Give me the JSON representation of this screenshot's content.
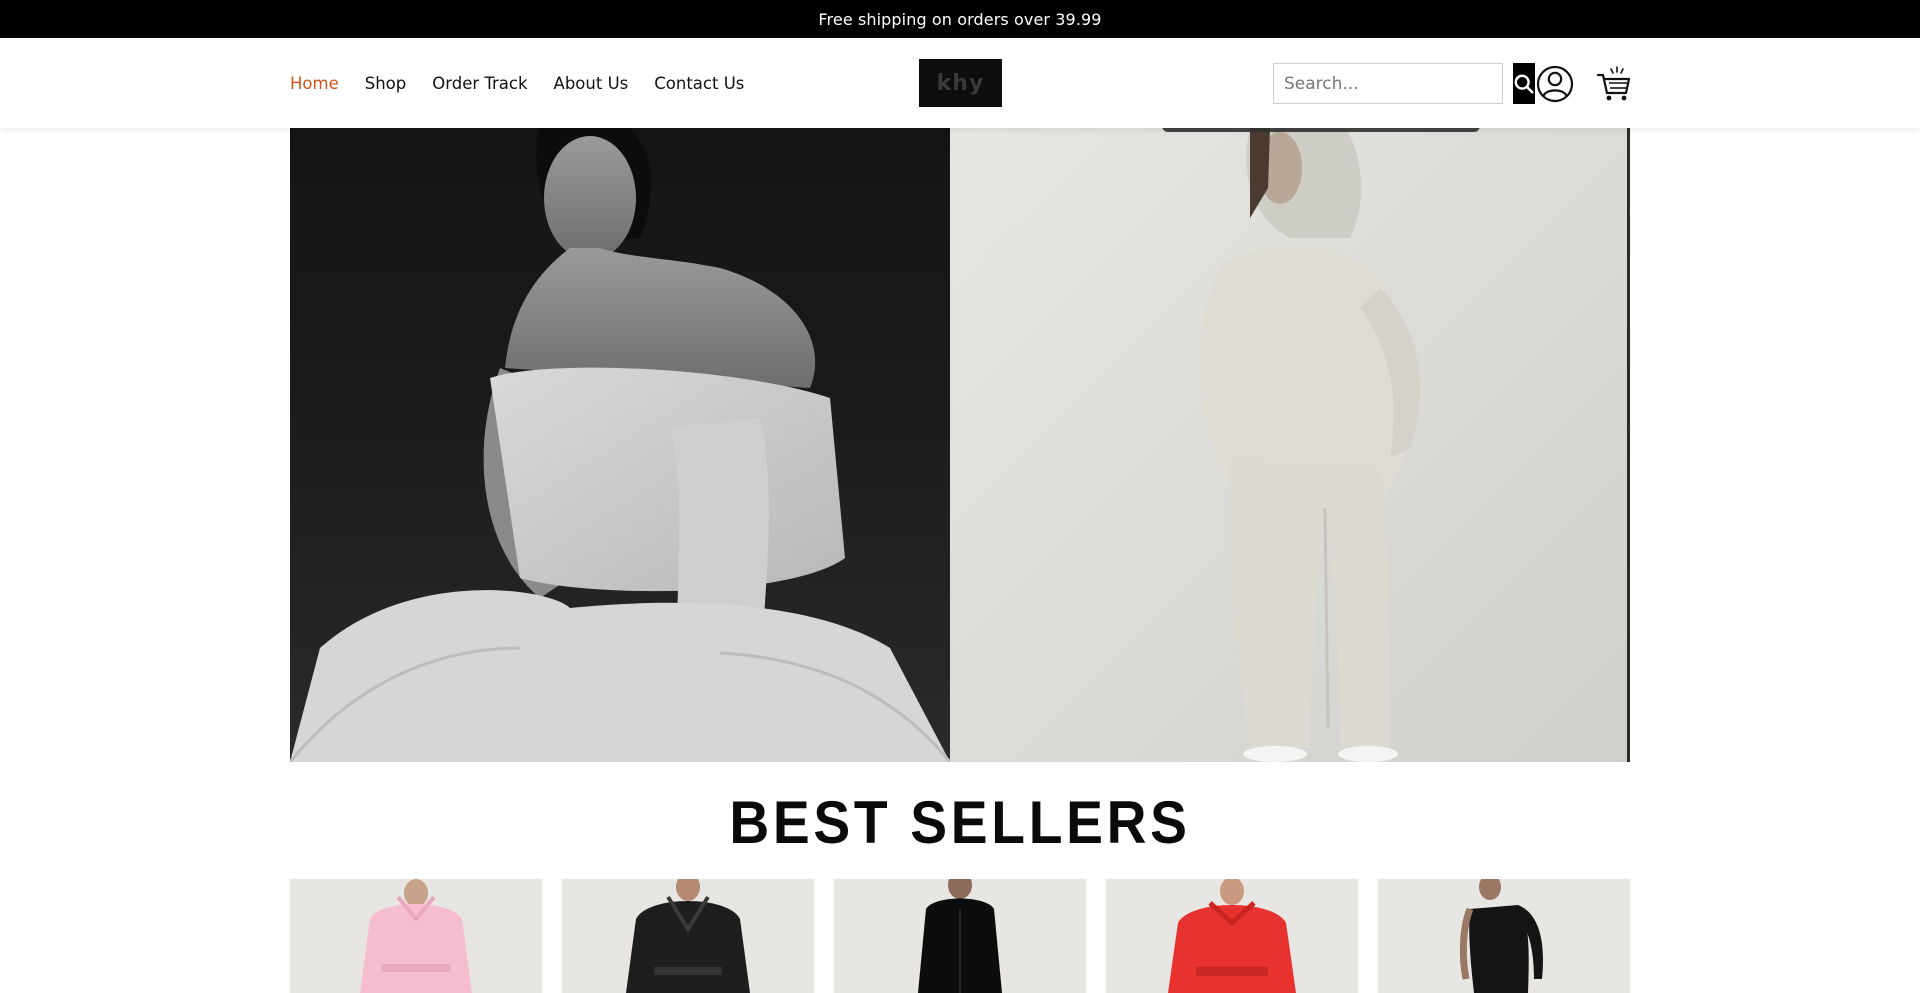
{
  "announcement": {
    "text": "Free shipping on orders over 39.99"
  },
  "nav": {
    "items": [
      {
        "label": "Home",
        "active": true
      },
      {
        "label": "Shop",
        "active": false
      },
      {
        "label": "Order Track",
        "active": false
      },
      {
        "label": "About Us",
        "active": false
      },
      {
        "label": "Contact Us",
        "active": false
      }
    ]
  },
  "logo": {
    "text": "khy"
  },
  "search": {
    "placeholder": "Search...",
    "value": ""
  },
  "icons": {
    "search": "search-icon",
    "account": "user-icon",
    "cart": "cart-icon"
  },
  "colors": {
    "accent": "#d2531a",
    "announcement_bg": "#000000",
    "text": "#111111"
  },
  "best_sellers": {
    "title": "BEST SELLERS",
    "products": [
      {
        "color": "#f6bcd0"
      },
      {
        "color": "#1e1e1e"
      },
      {
        "color": "#0c0c0c"
      },
      {
        "color": "#e8322f"
      },
      {
        "color": "#141414"
      }
    ]
  }
}
